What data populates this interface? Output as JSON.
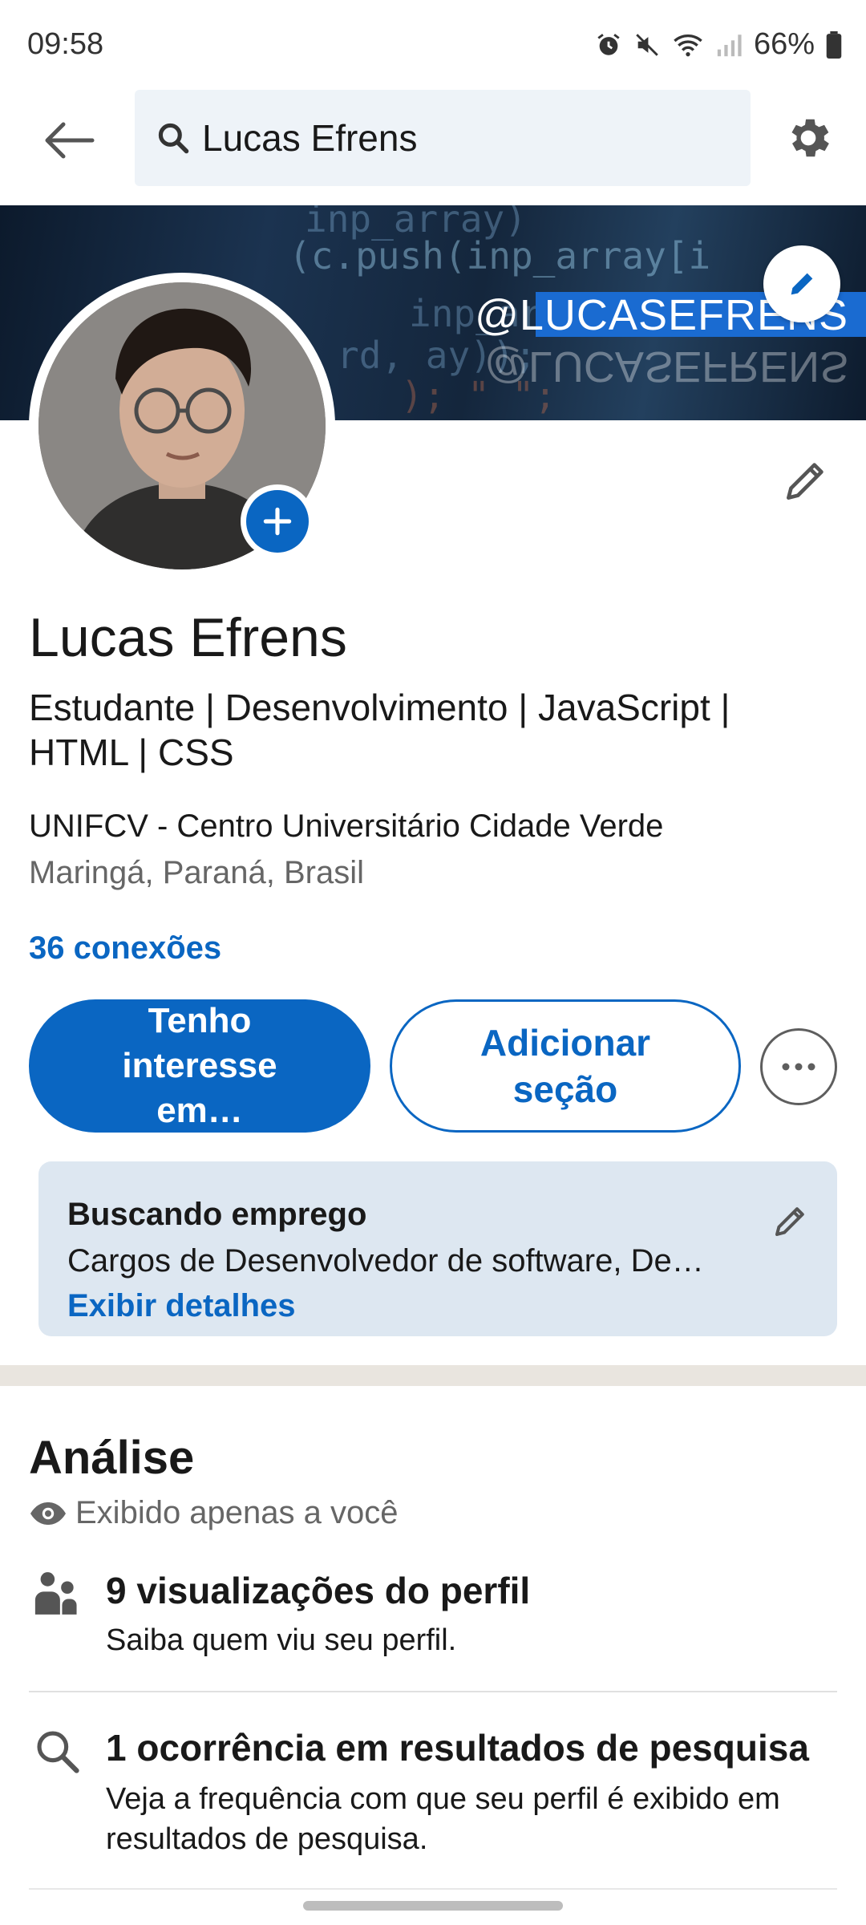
{
  "status_bar": {
    "time": "09:58",
    "battery": "66%"
  },
  "search": {
    "query": "Lucas Efrens"
  },
  "banner": {
    "handle": "@LUCASEFRENS",
    "handle_mirror": "@LUCASEFRENS",
    "code_lines": [
      "inp_array)",
      "(c.push(inp_array[i",
      "inp_arr",
      "rd,  ay));",
      ");  \"  \";"
    ]
  },
  "profile": {
    "name": "Lucas Efrens",
    "headline": "Estudante | Desenvolvimento | JavaScript | HTML | CSS",
    "institution": "UNIFCV - Centro Universitário Cidade Verde",
    "location": "Maringá, Paraná, Brasil",
    "connections": "36 conexões"
  },
  "actions": {
    "primary": "Tenho interesse em…",
    "secondary": "Adicionar seção"
  },
  "open_to_work": {
    "title": "Buscando emprego",
    "description": "Cargos de Desenvolvedor de software, De…",
    "link": "Exibir detalhes"
  },
  "analytics": {
    "title": "Análise",
    "private_note": "Exibido apenas a você",
    "items": [
      {
        "title": "9 visualizações do perfil",
        "subtitle": "Saiba quem viu seu perfil.",
        "icon": "people-icon"
      },
      {
        "title": "1 ocorrência em resultados de pesquisa",
        "subtitle": "Veja a frequência com que seu perfil é exibido em resultados de pesquisa.",
        "icon": "search-icon"
      }
    ]
  },
  "colors": {
    "accent": "#0a66c2",
    "card_bg": "#dde7f1",
    "search_bg": "#eef3f8"
  }
}
